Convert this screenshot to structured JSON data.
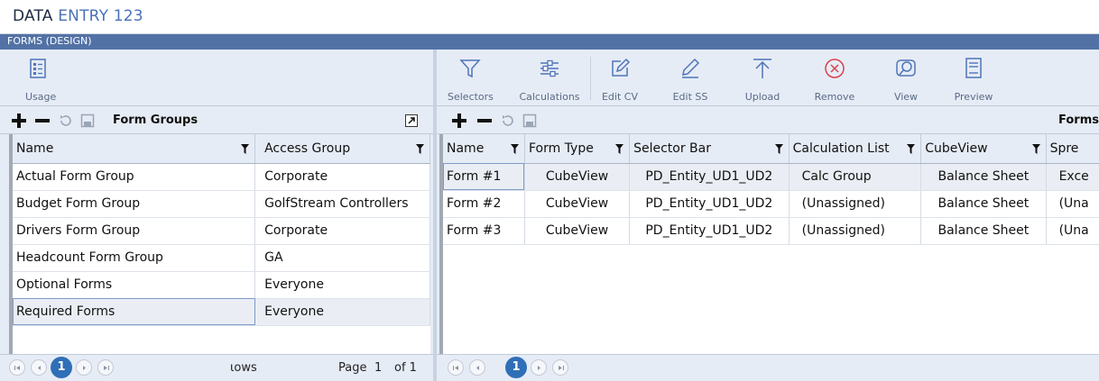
{
  "app": {
    "title_main": "DATA",
    "title_sub": "ENTRY 123",
    "page_band": "FORMS (DESIGN)"
  },
  "left": {
    "ribbon": {
      "usage": "Usage"
    },
    "toolbar_title": "Form Groups",
    "columns": [
      "Name",
      "Access Group"
    ],
    "rows": [
      [
        "Actual Form Group",
        "Corporate"
      ],
      [
        "Budget Form Group",
        "GolfStream Controllers"
      ],
      [
        "Drivers Form Group",
        "Corporate"
      ],
      [
        "Headcount Form Group",
        "GA"
      ],
      [
        "Optional Forms",
        "Everyone"
      ],
      [
        "Required Forms",
        "Everyone"
      ]
    ],
    "pager": {
      "current": "1",
      "rows_label": "ιows",
      "page_label": "Page",
      "page_num": "1",
      "of_label": "of 1"
    }
  },
  "right": {
    "ribbon": {
      "selectors": "Selectors",
      "calculations": "Calculations",
      "edit_cv": "Edit CV",
      "edit_ss": "Edit SS",
      "upload": "Upload",
      "remove": "Remove",
      "view": "View",
      "preview": "Preview"
    },
    "toolbar_title": "Forms",
    "columns": [
      "Name",
      "Form Type",
      "Selector Bar",
      "Calculation List",
      "CubeView",
      "Spre"
    ],
    "rows": [
      [
        "Form #1",
        "CubeView",
        "PD_Entity_UD1_UD2",
        "Calc Group",
        "Balance Sheet",
        "Exce"
      ],
      [
        "Form #2",
        "CubeView",
        "PD_Entity_UD1_UD2",
        "(Unassigned)",
        "Balance Sheet",
        "(Una"
      ],
      [
        "Form #3",
        "CubeView",
        "PD_Entity_UD1_UD2",
        "(Unassigned)",
        "Balance Sheet",
        "(Una"
      ]
    ],
    "pager": {
      "current": "1"
    }
  },
  "colors": {
    "accent": "#2f6fb7",
    "band": "#5272a6",
    "panel": "#e6ecf5",
    "remove_red": "#d9414c",
    "icon_blue": "#4f74b9"
  }
}
